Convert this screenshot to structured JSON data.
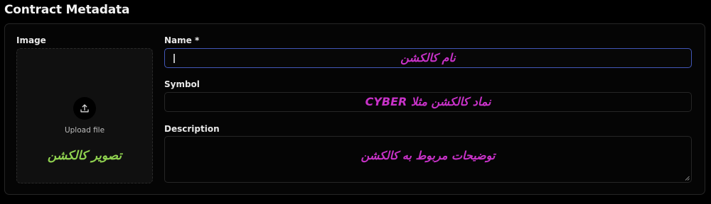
{
  "page": {
    "title": "Contract Metadata"
  },
  "image_section": {
    "label": "Image",
    "upload_label": "Upload file",
    "caption": "تصویر کالکشن",
    "upload_icon": "upload-icon"
  },
  "name_field": {
    "label": "Name",
    "required_marker": "*",
    "value": "",
    "hint": "نام کالکشن"
  },
  "symbol_field": {
    "label": "Symbol",
    "value": "",
    "hint": "نماد کالکشن مثلا CYBER"
  },
  "description_field": {
    "label": "Description",
    "value": "",
    "hint": "توضیحات مربوط به کالکشن"
  },
  "colors": {
    "background": "#000000",
    "focus_border": "#4257b8",
    "hint_magenta": "#c832c8",
    "caption_green": "#8fd14f"
  }
}
